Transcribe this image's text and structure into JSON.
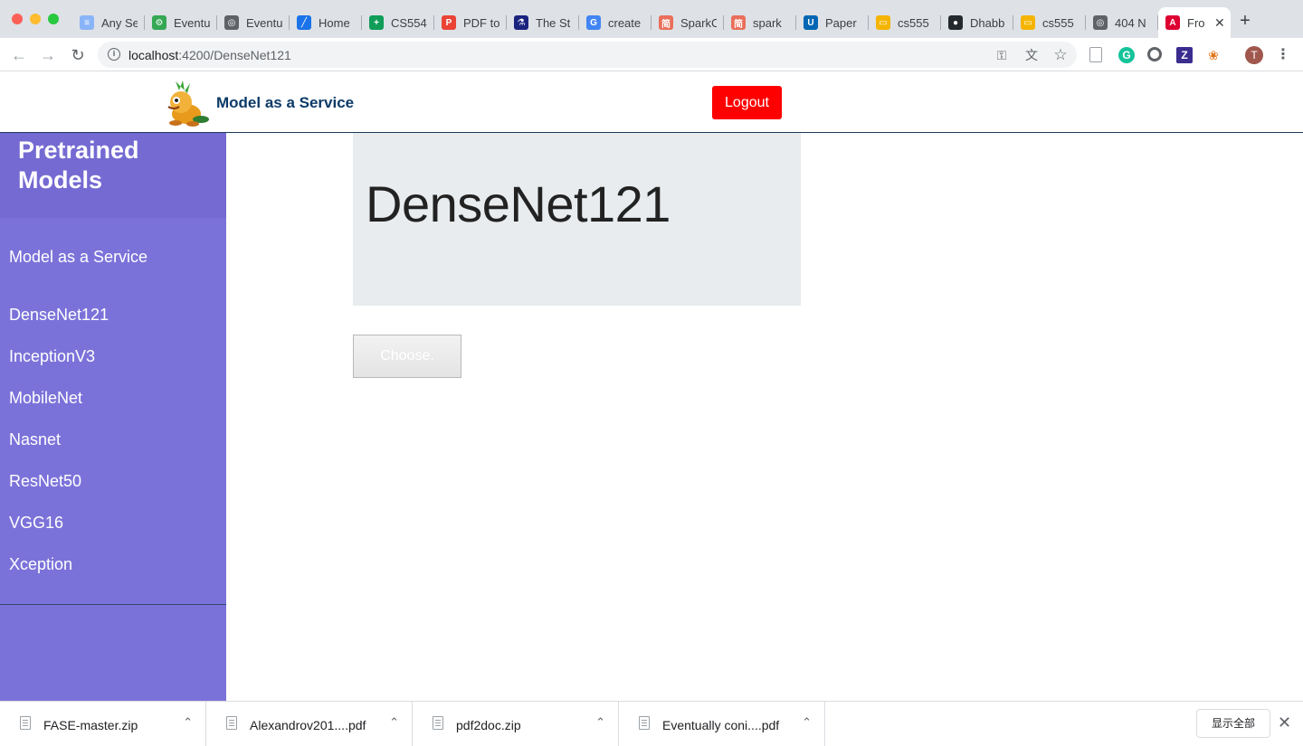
{
  "browser": {
    "tabs": [
      {
        "label": "Any Se",
        "icon": "doc-icon",
        "color": "#8ab4f8"
      },
      {
        "label": "Eventu",
        "icon": "bug-icon",
        "color": "#34a853"
      },
      {
        "label": "Eventu",
        "icon": "globe-icon",
        "color": "#5f6368"
      },
      {
        "label": "Home",
        "icon": "chart-icon",
        "color": "#1a73e8"
      },
      {
        "label": "CS554",
        "icon": "sheets-icon",
        "color": "#0f9d58"
      },
      {
        "label": "PDF to",
        "icon": "pdfdoc-icon",
        "color": "#ea4335"
      },
      {
        "label": "The St",
        "icon": "flask-icon",
        "color": "#1a237e"
      },
      {
        "label": "create",
        "icon": "google-icon",
        "color": "#4285f4"
      },
      {
        "label": "SparkC",
        "icon": "jianshu-icon",
        "color": "#ea6f5a"
      },
      {
        "label": "spark",
        "icon": "jianshu-icon",
        "color": "#ea6f5a"
      },
      {
        "label": "Paper",
        "icon": "umkc-icon",
        "color": "#0066b3"
      },
      {
        "label": "cs555",
        "icon": "slides-icon",
        "color": "#f4b400"
      },
      {
        "label": "Dhabb",
        "icon": "github-icon",
        "color": "#24292e"
      },
      {
        "label": "cs555",
        "icon": "slides-icon",
        "color": "#f4b400"
      },
      {
        "label": "404 N",
        "icon": "globe-icon",
        "color": "#5f6368"
      },
      {
        "label": "Fro",
        "icon": "angular-icon",
        "color": "#dd0031",
        "active": true
      }
    ],
    "url_host": "localhost",
    "url_rest": ":4200/DenseNet121",
    "extension_letter": "Z",
    "avatar_letter": "T"
  },
  "header": {
    "brand": "Model as a Service",
    "logout_label": "Logout"
  },
  "sidebar": {
    "title": "Pretrained Models",
    "subtitle": "Model as a Service",
    "items": [
      "DenseNet121",
      "InceptionV3",
      "MobileNet",
      "Nasnet",
      "ResNet50",
      "VGG16",
      "Xception"
    ]
  },
  "main": {
    "model_title": "DenseNet121",
    "choose_label": "Choose."
  },
  "downloads": {
    "items": [
      "FASE-master.zip",
      "Alexandrov201....pdf",
      "pdf2doc.zip",
      "Eventually coni....pdf"
    ],
    "show_all": "显示全部"
  },
  "colors": {
    "sidebar": "#7b72d9",
    "logout": "#ff0000",
    "brand": "#0b3a66"
  }
}
